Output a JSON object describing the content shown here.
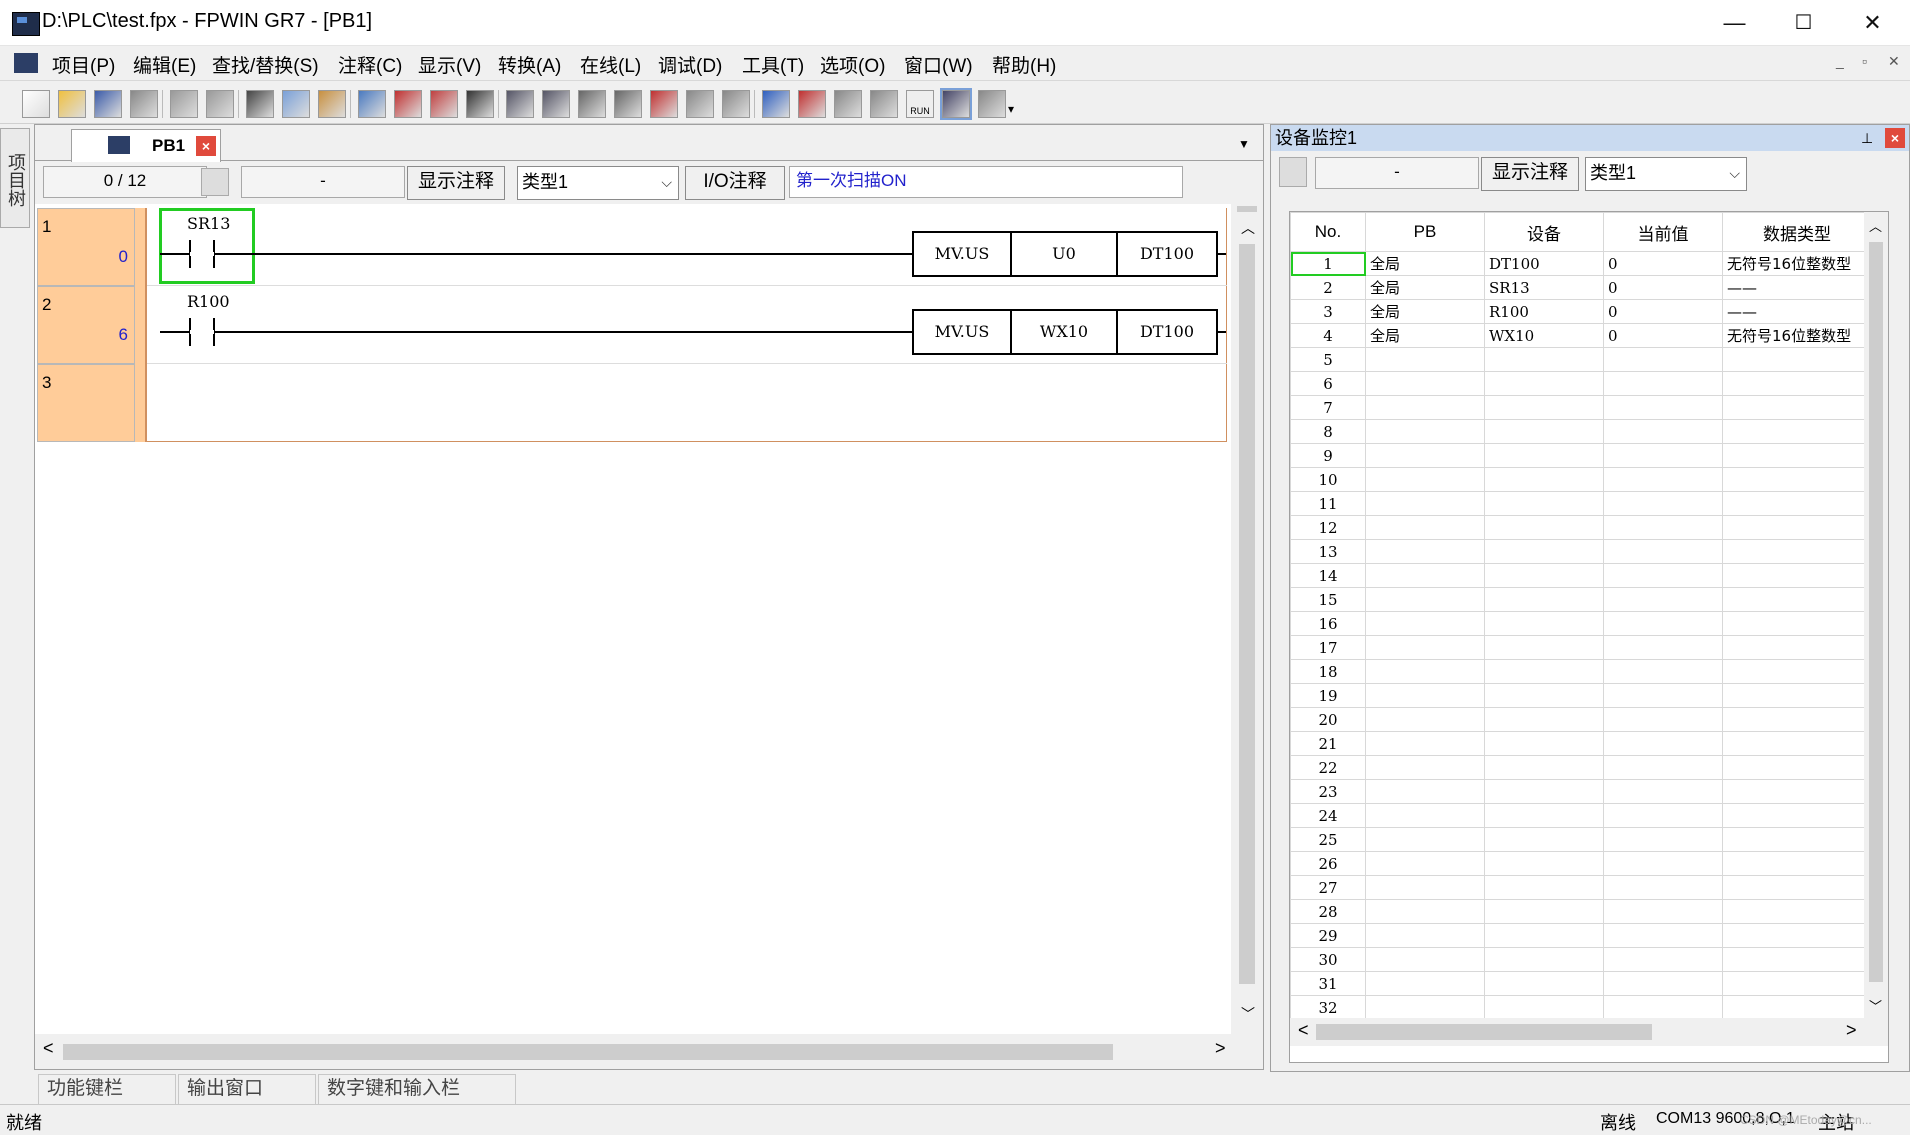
{
  "window": {
    "title": "D:\\PLC\\test.fpx - FPWIN GR7 - [PB1]",
    "minimize": "—",
    "maximize": "☐",
    "close": "✕"
  },
  "menu": {
    "items": [
      "项目(P)",
      "编辑(E)",
      "查找/替换(S)",
      "注释(C)",
      "显示(V)",
      "转换(A)",
      "在线(L)",
      "调试(D)",
      "工具(T)",
      "选项(O)",
      "窗口(W)",
      "帮助(H)"
    ],
    "mdi_min": "_",
    "mdi_restore": "▫",
    "mdi_close": "✕"
  },
  "toolbar": {
    "icons": [
      "new-icon",
      "open-icon",
      "save-icon",
      "print-icon",
      "undo-icon",
      "redo-icon",
      "cut-icon",
      "copy-icon",
      "paste-icon",
      "insert-row-icon",
      "delete-row-icon",
      "replace-icon",
      "find-icon",
      "list-icon",
      "monitor-icon",
      "block-icon",
      "block2-icon",
      "compile-icon",
      "pg-icon",
      "pg2-icon",
      "download-icon",
      "upload-icon",
      "debug-icon",
      "debug2-icon",
      "run-icon",
      "view-icon",
      "view2-icon"
    ],
    "run_label": "RUN"
  },
  "left_strip": {
    "label": "项目树"
  },
  "editor": {
    "tab": {
      "label": "PB1",
      "close": "×"
    },
    "step_counter": "0 /    12",
    "step_field": "-",
    "show_comment_button": "显示注释",
    "type_combo": "类型1",
    "io_comment_button": "I/O注释",
    "comment_text": "第一次扫描ON",
    "rungs": [
      {
        "number": "1",
        "step": "0",
        "contact": "SR13",
        "instr": [
          "MV.US",
          "U0",
          "DT100"
        ]
      },
      {
        "number": "2",
        "step": "6",
        "contact": "R100",
        "instr": [
          "MV.US",
          "WX10",
          "DT100"
        ]
      },
      {
        "number": "3",
        "step": "",
        "contact": "",
        "instr": []
      }
    ],
    "hscroll_left": "<",
    "hscroll_right": ">",
    "vscroll_up": "^",
    "vscroll_down": "v"
  },
  "bottom_tabs": [
    "功能键栏",
    "输出窗口",
    "数字键和输入栏"
  ],
  "status": {
    "left": "就绪",
    "offline": "离线",
    "port": "COM13 9600,8,O,1",
    "station": "主站",
    "watermark": "CSDN @MEtoday@cn..."
  },
  "monitor": {
    "title": "设备监控1",
    "pin": "ᛘ",
    "close": "×",
    "field": "-",
    "show_comment_button": "显示注释",
    "type_combo": "类型1",
    "columns": [
      "No.",
      "PB",
      "设备",
      "当前值",
      "数据类型"
    ],
    "rows": [
      {
        "no": "1",
        "pb": "全局",
        "device": "DT100",
        "value": "0",
        "dtype": "无符号16位整数型"
      },
      {
        "no": "2",
        "pb": "全局",
        "device": "SR13",
        "value": "0",
        "dtype": "——"
      },
      {
        "no": "3",
        "pb": "全局",
        "device": "R100",
        "value": "0",
        "dtype": "——"
      },
      {
        "no": "4",
        "pb": "全局",
        "device": "WX10",
        "value": "0",
        "dtype": "无符号16位整数型"
      },
      {
        "no": "5"
      },
      {
        "no": "6"
      },
      {
        "no": "7"
      },
      {
        "no": "8"
      },
      {
        "no": "9"
      },
      {
        "no": "10"
      },
      {
        "no": "11"
      },
      {
        "no": "12"
      },
      {
        "no": "13"
      },
      {
        "no": "14"
      },
      {
        "no": "15"
      },
      {
        "no": "16"
      },
      {
        "no": "17"
      },
      {
        "no": "18"
      },
      {
        "no": "19"
      },
      {
        "no": "20"
      },
      {
        "no": "21"
      },
      {
        "no": "22"
      },
      {
        "no": "23"
      },
      {
        "no": "24"
      },
      {
        "no": "25"
      },
      {
        "no": "26"
      },
      {
        "no": "27"
      },
      {
        "no": "28"
      },
      {
        "no": "29"
      },
      {
        "no": "30"
      },
      {
        "no": "31"
      },
      {
        "no": "32"
      }
    ],
    "hscroll_left": "<",
    "hscroll_right": ">"
  },
  "colors": {
    "rung_bg": "#ffcc99",
    "select_green": "#22cc22",
    "comment_blue": "#2222cc",
    "title_panel": "#c9daf0"
  }
}
